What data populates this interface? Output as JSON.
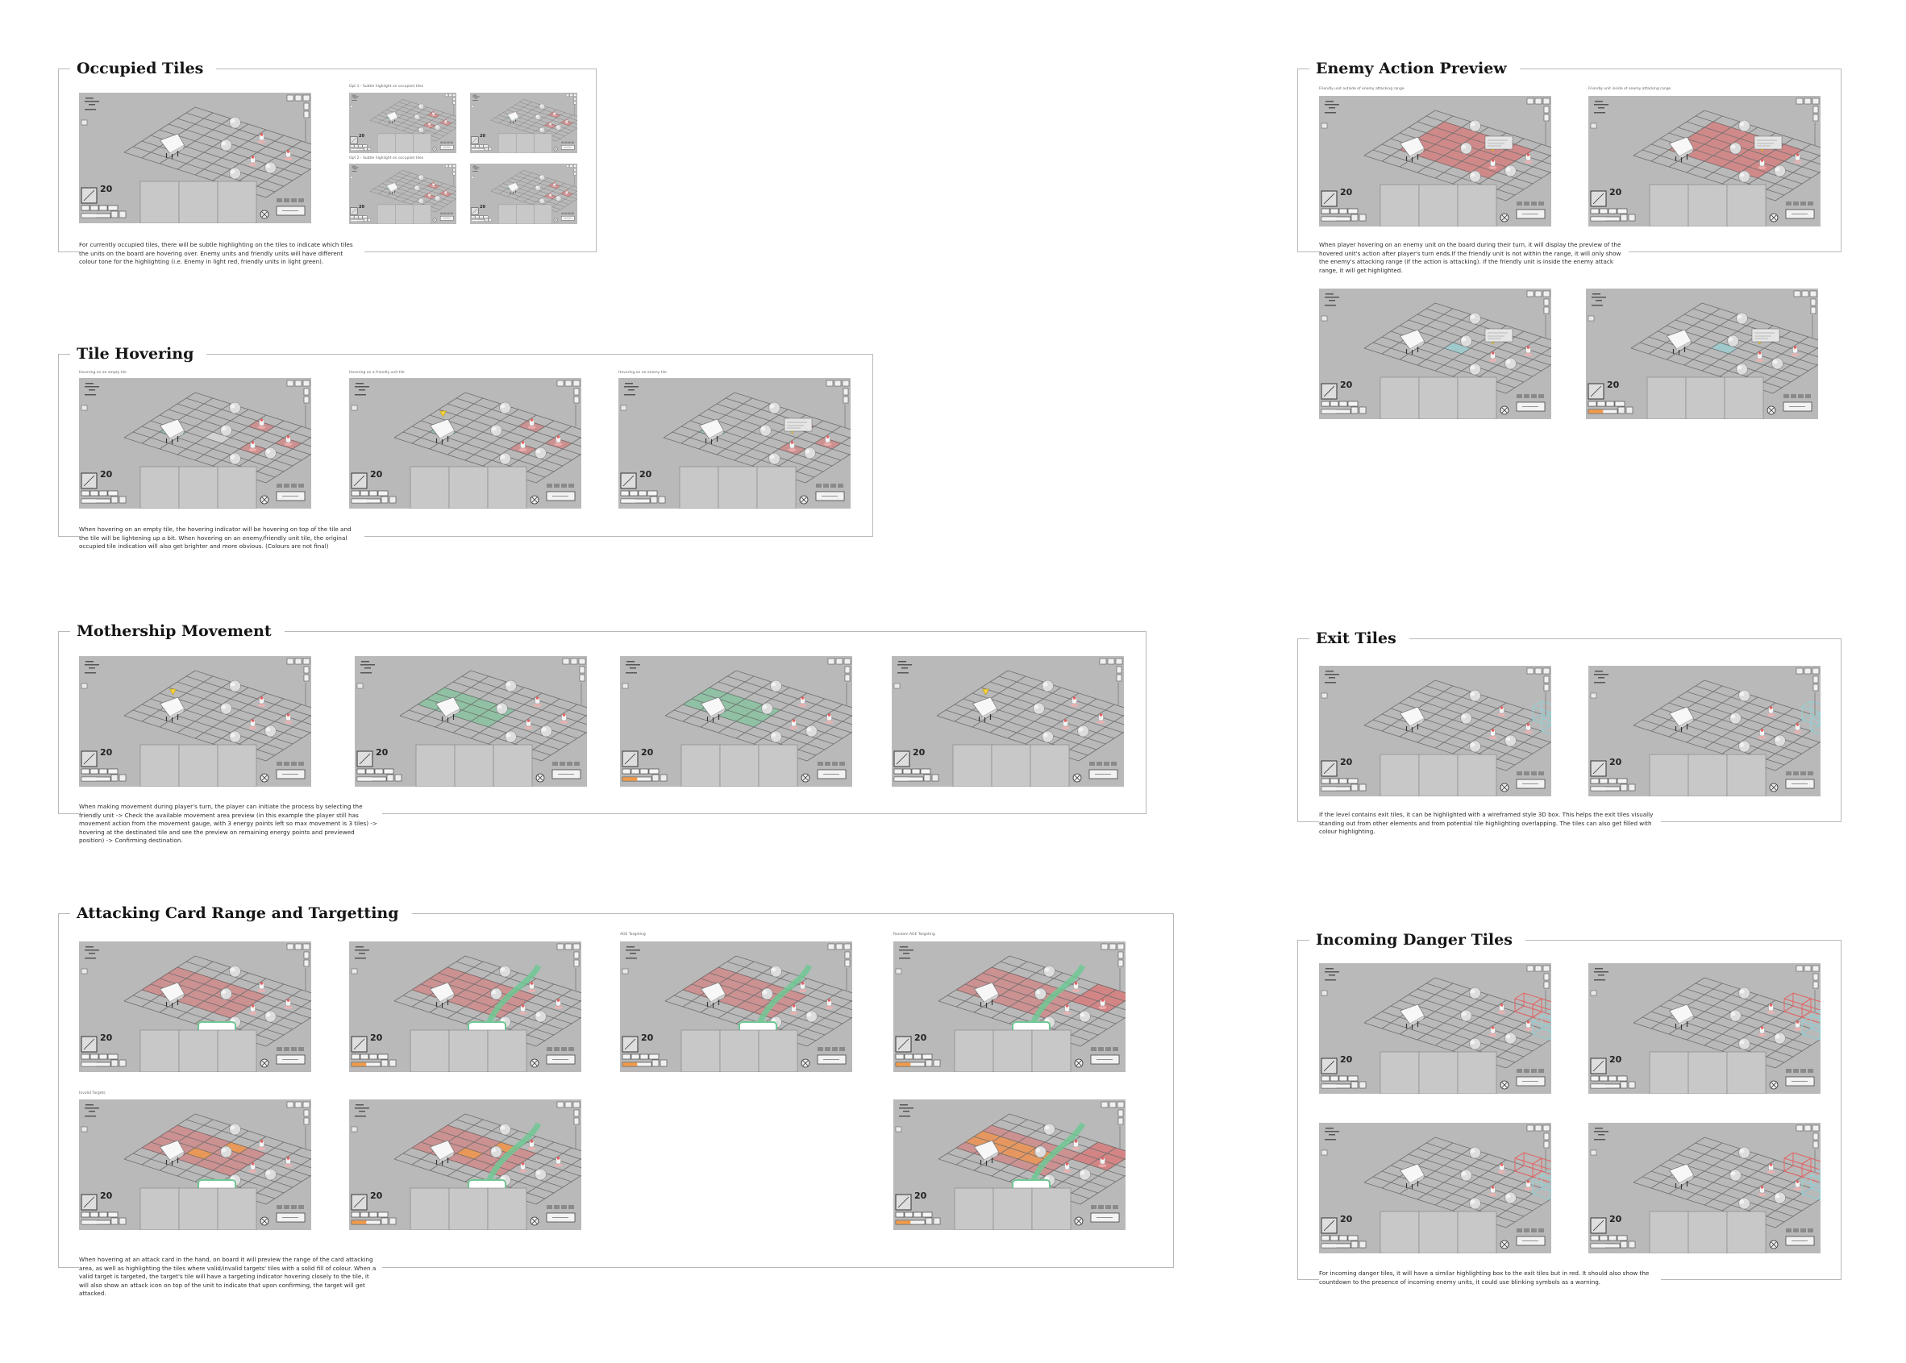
{
  "colors": {
    "screen": "#b9b9b9",
    "grid": "#6f6f6f",
    "enemy": "#e46262",
    "friendly": "#6fc894",
    "exit": "#8fd3d8",
    "orange": "#f09a4a",
    "border": "#b9b9b9"
  },
  "icons": [
    "mothership-icon",
    "enemy-unit-icon",
    "rock-icon",
    "card-icon",
    "close-icon",
    "end-turn-icon"
  ],
  "mock_hud": {
    "energy_value": "20"
  },
  "sections": {
    "occupied": {
      "title": "Occupied Tiles",
      "desc": "For currently occupied tiles, there will be subtle highlighting on the tiles to indicate which tiles the units on the board are hovering over. Enemy units and friendly units will have different colour tone for the highlighting (i.e. Enemy in light red, friendly units in light green).",
      "captions": [
        "Opt 1 - Subtle highlight on occupied tiles",
        "Opt 2 - Subtle highlight on occupied tiles"
      ]
    },
    "hovering": {
      "title": "Tile Hovering",
      "desc": "When hovering on an empty tile, the hovering indicator will be hovering on top of the tile and the tile will be lightening up a bit. When hovering on an enemy/friendly unit tile, the original occupied tile indication will also get brighter and more obvious. (Colours are not final)",
      "captions": [
        "Hovering on an empty tile",
        "Hovering on a friendly unit tile",
        "Hovering on an enemy tile"
      ]
    },
    "mothership": {
      "title": "Mothership Movement",
      "desc": "When making movement during player's turn, the player can initiate the process by selecting the friendly unit -> Check the available movement area preview (in this example the player still has movement action from the movement gauge, with 3 energy points left so max movement is 3 tiles) -> hovering at the destinated tile and see the preview on remaining energy points and previewed position) -> Confirming destination."
    },
    "attacking": {
      "title": "Attacking Card Range and Targetting",
      "desc": "When hovering at an attack card in the hand, on board it will preview the range of the card attacking area, as well as highlighting the tiles where valid/invalid targets' tiles with a solid fill of colour. When a valid target is targeted, the target's tile will have a targeting indicator hovering closely to the tile, it will also show an attack icon on top of the unit to indicate that upon confirming, the target will get attacked.",
      "captions": [
        "AOE Targeting",
        "Random AOE Targeting",
        "Invalid Targets"
      ]
    },
    "enemy_preview": {
      "title": "Enemy Action Preview",
      "desc": "When player hovering on an enemy unit on the board during their turn, it will display the preview of the hovered unit's action after player's turn ends.If the friendly unit is not within the range, it will only show the enemy's attacking range (if the action is attacking). If the friendly unit is inside the enemy attack range, it will get highlighted.",
      "captions": [
        "Friendly unit outside of enemy attacking range",
        "Friendly unit inside of enemy attacking range"
      ]
    },
    "exit": {
      "title": "Exit Tiles",
      "desc": "If the level contains exit tiles, it can be highlighted with a wireframed style 3D box. This helps the exit tiles visually standing out from other elements and from potential tile highlighting overlapping. The tiles can also get filled with colour highlighting."
    },
    "danger": {
      "title": "Incoming Danger Tiles",
      "desc": "For incoming danger tiles, it will have a similar highlighting box to the exit tiles but in red. It should also show the countdown to the presence of incoming enemy units, it could use blinking symbols as a warning."
    }
  }
}
